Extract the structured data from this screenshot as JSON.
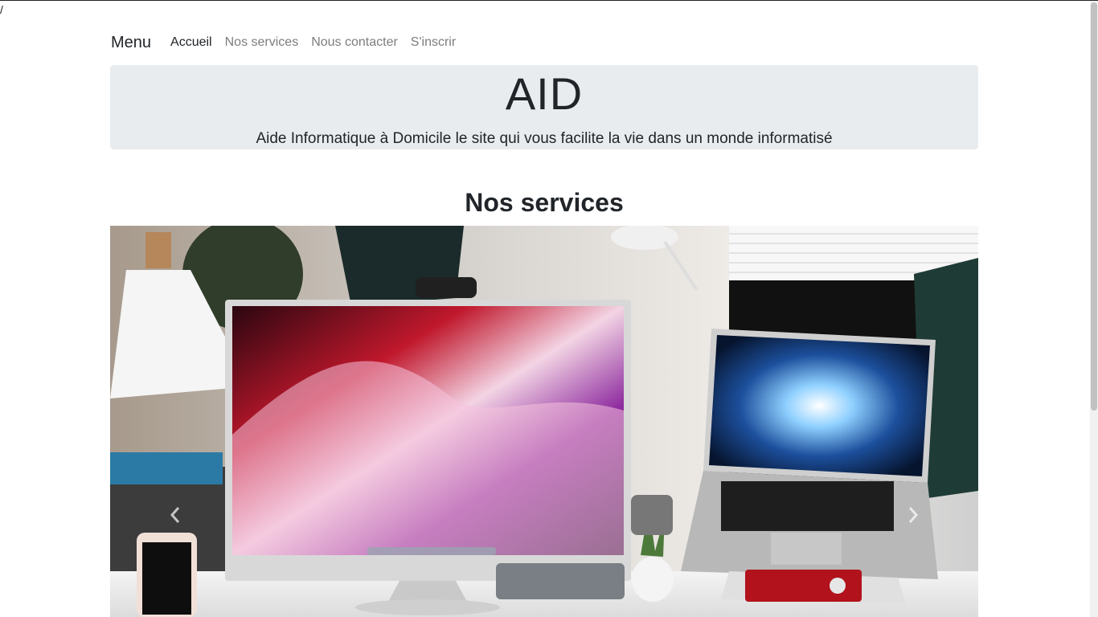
{
  "page": {
    "stray_text": "/"
  },
  "navbar": {
    "brand": "Menu",
    "links": [
      {
        "label": "Accueil",
        "active": true
      },
      {
        "label": "Nos services",
        "active": false
      },
      {
        "label": "Nous contacter",
        "active": false
      },
      {
        "label": "S'inscrir",
        "active": false
      }
    ]
  },
  "jumbotron": {
    "title": "AID",
    "lead": "Aide Informatique à Domicile le site qui vous facilite la vie dans un monde informatisé",
    "background": "#e9ecef"
  },
  "services": {
    "title": "Nos services",
    "carousel": {
      "image_alt": "Bureau avec écran LG, ordinateur portable et webcam",
      "prev_icon": "chevron-left-icon",
      "next_icon": "chevron-right-icon"
    }
  }
}
